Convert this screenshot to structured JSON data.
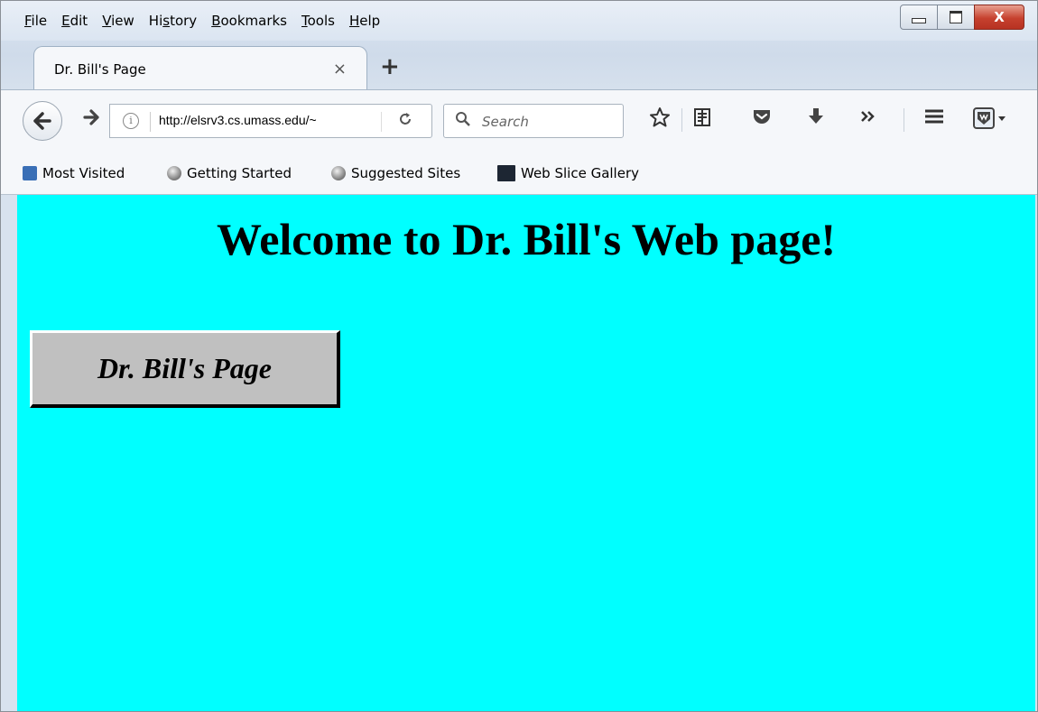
{
  "menubar": {
    "items": [
      {
        "pre": "",
        "u": "F",
        "post": "ile"
      },
      {
        "pre": "",
        "u": "E",
        "post": "dit"
      },
      {
        "pre": "",
        "u": "V",
        "post": "iew"
      },
      {
        "pre": "Hi",
        "u": "s",
        "post": "tory"
      },
      {
        "pre": "",
        "u": "B",
        "post": "ookmarks"
      },
      {
        "pre": "",
        "u": "T",
        "post": "ools"
      },
      {
        "pre": "",
        "u": "H",
        "post": "elp"
      }
    ]
  },
  "window_controls": {
    "close_glyph": "X"
  },
  "tab": {
    "title": "Dr. Bill's Page",
    "close_glyph": "×",
    "new_tab_glyph": "+"
  },
  "nav": {
    "url": "http://elsrv3.cs.umass.edu/~",
    "info_glyph": "i",
    "search_placeholder": "Search"
  },
  "toolbar_icons": [
    "bookmark-star-icon",
    "reading-list-icon",
    "pocket-icon",
    "downloads-icon",
    "overflow-icon",
    "hamburger-menu-icon",
    "extension-icon"
  ],
  "bookmarks": [
    {
      "label": "Most Visited",
      "icon": "most-visited-icon"
    },
    {
      "label": "Getting Started",
      "icon": "globe-icon"
    },
    {
      "label": "Suggested Sites",
      "icon": "globe-icon"
    },
    {
      "label": "Web Slice Gallery",
      "icon": "web-slice-icon"
    }
  ],
  "page": {
    "background": "#00ffff",
    "heading": "Welcome to Dr. Bill's Web page!",
    "button_label": "Dr. Bill's Page"
  }
}
